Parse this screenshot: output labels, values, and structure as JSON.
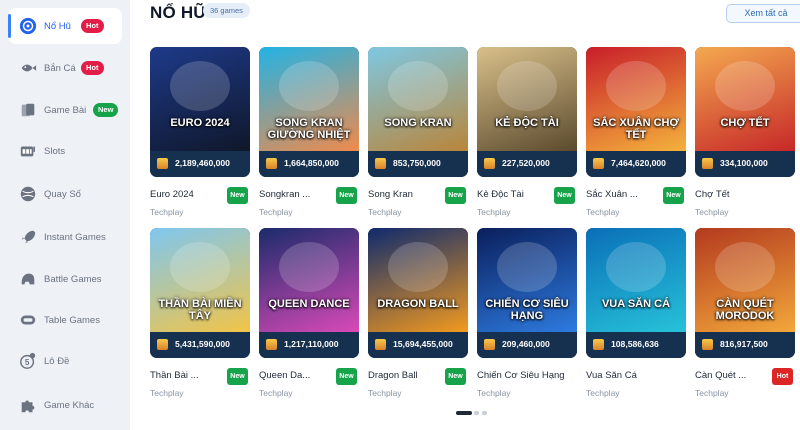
{
  "sidebar": {
    "items": [
      {
        "label": "Nổ Hũ",
        "badge": "Hot",
        "badge_type": "hot",
        "icon": "slot-jackpot-icon",
        "active": true
      },
      {
        "label": "Bắn Cá",
        "badge": "Hot",
        "badge_type": "hot",
        "icon": "fish-icon",
        "active": false
      },
      {
        "label": "Game Bài",
        "badge": "New",
        "badge_type": "new",
        "icon": "cards-icon",
        "active": false
      },
      {
        "label": "Slots",
        "badge": "",
        "badge_type": "",
        "icon": "slot-machine-icon",
        "active": false
      },
      {
        "label": "Quay Số",
        "badge": "",
        "badge_type": "",
        "icon": "lottery-ball-icon",
        "active": false
      },
      {
        "label": "Instant Games",
        "badge": "",
        "badge_type": "",
        "icon": "rocket-icon",
        "active": false
      },
      {
        "label": "Battle Games",
        "badge": "",
        "badge_type": "",
        "icon": "helmet-icon",
        "active": false
      },
      {
        "label": "Table Games",
        "badge": "",
        "badge_type": "",
        "icon": "table-icon",
        "active": false
      },
      {
        "label": "Lô Đề",
        "badge": "",
        "badge_type": "",
        "icon": "number-five-icon",
        "active": false
      },
      {
        "label": "Game Khác",
        "badge": "",
        "badge_type": "",
        "icon": "puzzle-icon",
        "active": false
      }
    ]
  },
  "header": {
    "title": "NỔ HŨ",
    "count": "36 games",
    "view_all": "Xem tất cả"
  },
  "games": [
    {
      "name": "Euro 2024",
      "provider": "Techplay",
      "jackpot": "2,189,460,000",
      "tag": "New",
      "art_title": "EURO 2024",
      "colors": [
        "#1e3a8a",
        "#0f172a"
      ]
    },
    {
      "name": "Songkran ...",
      "provider": "Techplay",
      "jackpot": "1,664,850,000",
      "tag": "New",
      "art_title": "SONG KRAN GIƯỜNG NHIỆT",
      "colors": [
        "#22b3e6",
        "#f08a4b"
      ]
    },
    {
      "name": "Song Kran",
      "provider": "Techplay",
      "jackpot": "853,750,000",
      "tag": "New",
      "art_title": "SONG KRAN",
      "colors": [
        "#7ec8e3",
        "#b9853a"
      ]
    },
    {
      "name": "Kẻ Độc Tài",
      "provider": "Techplay",
      "jackpot": "227,520,000",
      "tag": "New",
      "art_title": "KẺ ĐỘC TÀI",
      "colors": [
        "#d9c08a",
        "#5b4a2e"
      ]
    },
    {
      "name": "Sắc Xuân ...",
      "provider": "Techplay",
      "jackpot": "7,464,620,000",
      "tag": "New",
      "art_title": "SẮC XUÂN CHỢ TẾT",
      "colors": [
        "#c81e2a",
        "#f4b23c"
      ]
    },
    {
      "name": "Chợ Tết",
      "provider": "Techplay",
      "jackpot": "334,100,000",
      "tag": "",
      "art_title": "CHỢ TẾT",
      "colors": [
        "#f4a950",
        "#c62828"
      ]
    },
    {
      "name": "Thần Bài ...",
      "provider": "Techplay",
      "jackpot": "5,431,590,000",
      "tag": "New",
      "art_title": "THẦN BÀI MIỀN TÂY",
      "colors": [
        "#7fc7f0",
        "#f2c447"
      ]
    },
    {
      "name": "Queen Da...",
      "provider": "Techplay",
      "jackpot": "1,217,110,000",
      "tag": "New",
      "art_title": "QUEEN DANCE",
      "colors": [
        "#1b2b6b",
        "#d94ab8"
      ]
    },
    {
      "name": "Dragon Ball",
      "provider": "Techplay",
      "jackpot": "15,694,455,000",
      "tag": "New",
      "art_title": "DRAGON BALL",
      "colors": [
        "#0e2a6e",
        "#f39a1e"
      ]
    },
    {
      "name": "Chiến Cơ Siêu Hạng",
      "provider": "Techplay",
      "jackpot": "209,460,000",
      "tag": "",
      "art_title": "CHIẾN CƠ SIÊU HẠNG",
      "colors": [
        "#0a1f5c",
        "#2e7be0"
      ]
    },
    {
      "name": "Vua Săn Cá",
      "provider": "Techplay",
      "jackpot": "108,586,636",
      "tag": "",
      "art_title": "VUA SĂN CÁ",
      "colors": [
        "#0a6fb8",
        "#27c2d9"
      ]
    },
    {
      "name": "Càn Quét ...",
      "provider": "Techplay",
      "jackpot": "816,917,500",
      "tag": "Hot",
      "art_title": "CÀN QUÉT MORODOK",
      "colors": [
        "#b33a1e",
        "#f2a73b"
      ]
    }
  ],
  "pagination": {
    "pages": 3,
    "current": 1
  }
}
